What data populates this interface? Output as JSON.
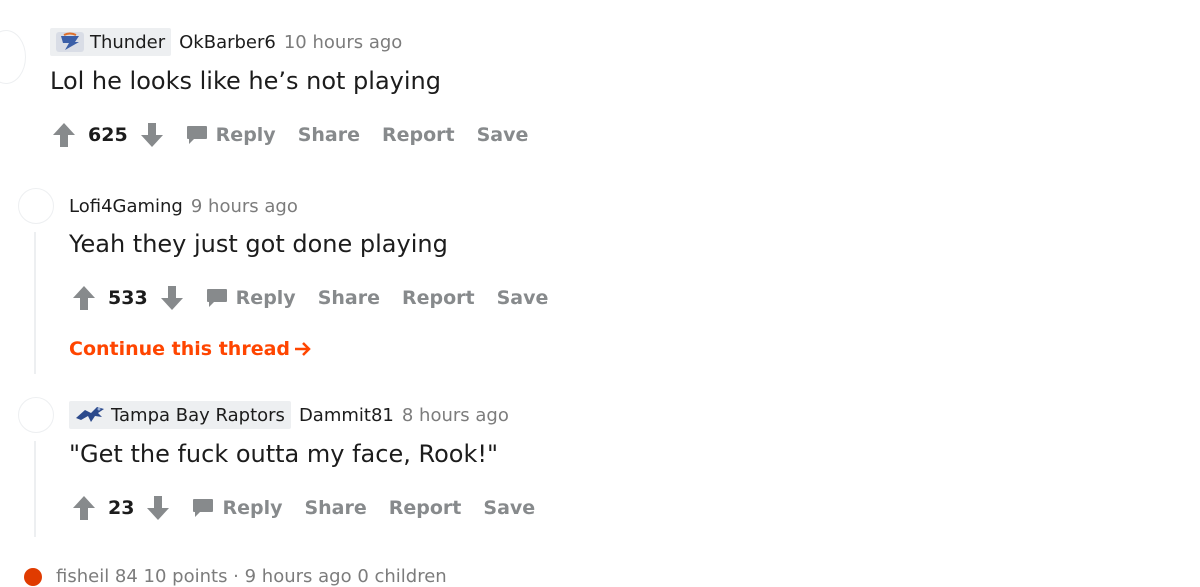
{
  "comments": [
    {
      "flair": "Thunder",
      "flair_icon": "thunder-logo-icon",
      "author": "OkBarber6",
      "time": "10 hours ago",
      "body": "Lol he looks like he’s not playing",
      "score": "625"
    },
    {
      "flair": "",
      "author": "Lofi4Gaming",
      "time": "9 hours ago",
      "body": "Yeah they just got done playing",
      "score": "533",
      "continue_label": "Continue this thread"
    },
    {
      "flair": "Tampa Bay Raptors",
      "flair_icon": "raptors-logo-icon",
      "author": "Dammit81",
      "time": "8 hours ago",
      "body": "\"Get the fuck outta my face, Rook!\"",
      "score": "23"
    }
  ],
  "actions": {
    "reply": "Reply",
    "share": "Share",
    "report": "Report",
    "save": "Save"
  },
  "collapsed": {
    "text": "fisheil  84 10 points · 9 hours ago  0 children"
  },
  "colors": {
    "accent": "#ff4500",
    "muted": "#878a8c",
    "flair_bg": "#edeff1"
  }
}
